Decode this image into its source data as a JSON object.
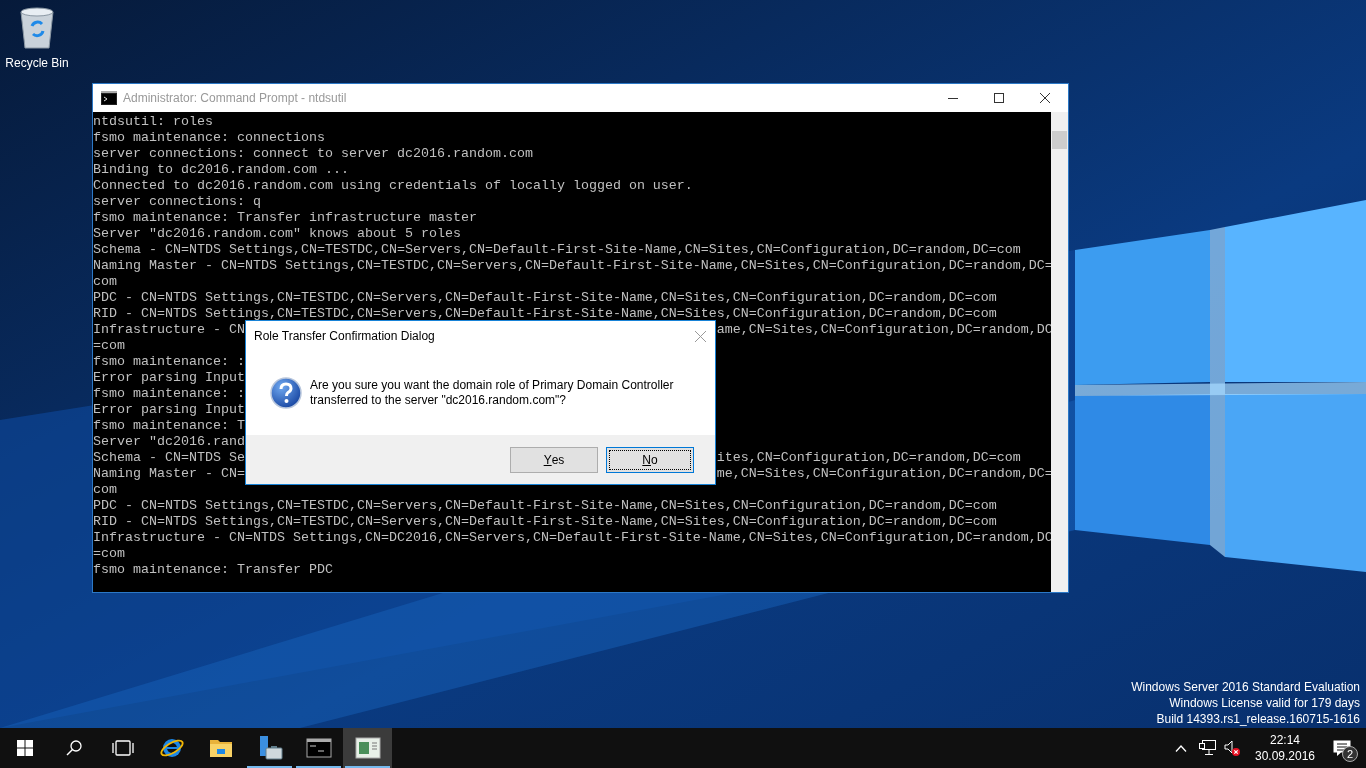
{
  "desktop": {
    "icons": [
      {
        "label": "Recycle Bin"
      }
    ],
    "info_lines": [
      "Windows Server 2016 Standard Evaluation",
      "Windows License valid for 179 days",
      "Build 14393.rs1_release.160715-1616"
    ]
  },
  "console_window": {
    "title": "Administrator: Command Prompt - ntdsutil",
    "lines": [
      {
        "kind": "full",
        "text": "ntdsutil: roles"
      },
      {
        "kind": "full",
        "text": "fsmo maintenance: connections"
      },
      {
        "kind": "full",
        "text": "server connections: connect to server dc2016.random.com"
      },
      {
        "kind": "full",
        "text": "Binding to dc2016.random.com ..."
      },
      {
        "kind": "full",
        "text": "Connected to dc2016.random.com using credentials of locally logged on user."
      },
      {
        "kind": "full",
        "text": "server connections: q"
      },
      {
        "kind": "full",
        "text": "fsmo maintenance: Transfer infrastructure master"
      },
      {
        "kind": "full",
        "text": "Server \"dc2016.random.com\" knows about 5 roles"
      },
      {
        "kind": "full",
        "text": "Schema - CN=NTDS Settings,CN=TESTDC,CN=Servers,CN=Default-First-Site-Name,CN=Sites,CN=Configuration,DC=random,DC=com"
      },
      {
        "kind": "full",
        "text": "Naming Master - CN=NTDS Settings,CN=TESTDC,CN=Servers,CN=Default-First-Site-Name,CN=Sites,CN=Configuration,DC=random,DC="
      },
      {
        "kind": "full",
        "text": "com"
      },
      {
        "kind": "full",
        "text": "PDC - CN=NTDS Settings,CN=TESTDC,CN=Servers,CN=Default-First-Site-Name,CN=Sites,CN=Configuration,DC=random,DC=com"
      },
      {
        "kind": "full",
        "text": "RID - CN=NTDS Settings,CN=TESTDC,CN=Servers,CN=Default-First-Site-Name,CN=Sites,CN=Configuration,DC=random,DC=com"
      },
      {
        "kind": "split",
        "left": "Infrastructure - CN",
        "right": "ame,CN=Sites,CN=Configuration,DC=random,DC"
      },
      {
        "kind": "full",
        "text": "=com"
      },
      {
        "kind": "split",
        "left": "fsmo maintenance: :"
      },
      {
        "kind": "split",
        "left": "Error parsing Input"
      },
      {
        "kind": "split",
        "left": "fsmo maintenance: :"
      },
      {
        "kind": "split",
        "left": "Error parsing Input"
      },
      {
        "kind": "split",
        "left": "fsmo maintenance: T"
      },
      {
        "kind": "split",
        "left": "Server \"dc2016.rand"
      },
      {
        "kind": "split",
        "left": "Schema - CN=NTDS Se",
        "right": "ites,CN=Configuration,DC=random,DC=com"
      },
      {
        "kind": "split",
        "left": "Naming Master - CN=",
        "right": "me,CN=Sites,CN=Configuration,DC=random,DC="
      },
      {
        "kind": "full",
        "text": "com"
      },
      {
        "kind": "full",
        "text": "PDC - CN=NTDS Settings,CN=TESTDC,CN=Servers,CN=Default-First-Site-Name,CN=Sites,CN=Configuration,DC=random,DC=com"
      },
      {
        "kind": "full",
        "text": "RID - CN=NTDS Settings,CN=TESTDC,CN=Servers,CN=Default-First-Site-Name,CN=Sites,CN=Configuration,DC=random,DC=com"
      },
      {
        "kind": "full",
        "text": "Infrastructure - CN=NTDS Settings,CN=DC2016,CN=Servers,CN=Default-First-Site-Name,CN=Sites,CN=Configuration,DC=random,DC"
      },
      {
        "kind": "full",
        "text": "=com"
      },
      {
        "kind": "full",
        "text": "fsmo maintenance: Transfer PDC"
      }
    ]
  },
  "dialog": {
    "title": "Role Transfer Confirmation Dialog",
    "message": "Are you sure you want the domain role of Primary Domain Controller transferred to the server \"dc2016.random.com\"?",
    "buttons": [
      {
        "label": "Yes",
        "underline_first": true,
        "focused": false
      },
      {
        "label": "No",
        "underline_first": true,
        "focused": true
      }
    ]
  },
  "taskbar": {
    "apps": [
      {
        "kind": "browser",
        "running": false,
        "active": false
      },
      {
        "kind": "folder",
        "running": false,
        "active": false
      },
      {
        "kind": "server",
        "running": true,
        "active": false
      },
      {
        "kind": "terminal",
        "running": true,
        "active": false
      },
      {
        "kind": "app-window",
        "running": true,
        "active": true
      }
    ],
    "clock": {
      "time": "22:14",
      "date": "30.09.2016"
    },
    "notifications": {
      "count": "2"
    }
  }
}
